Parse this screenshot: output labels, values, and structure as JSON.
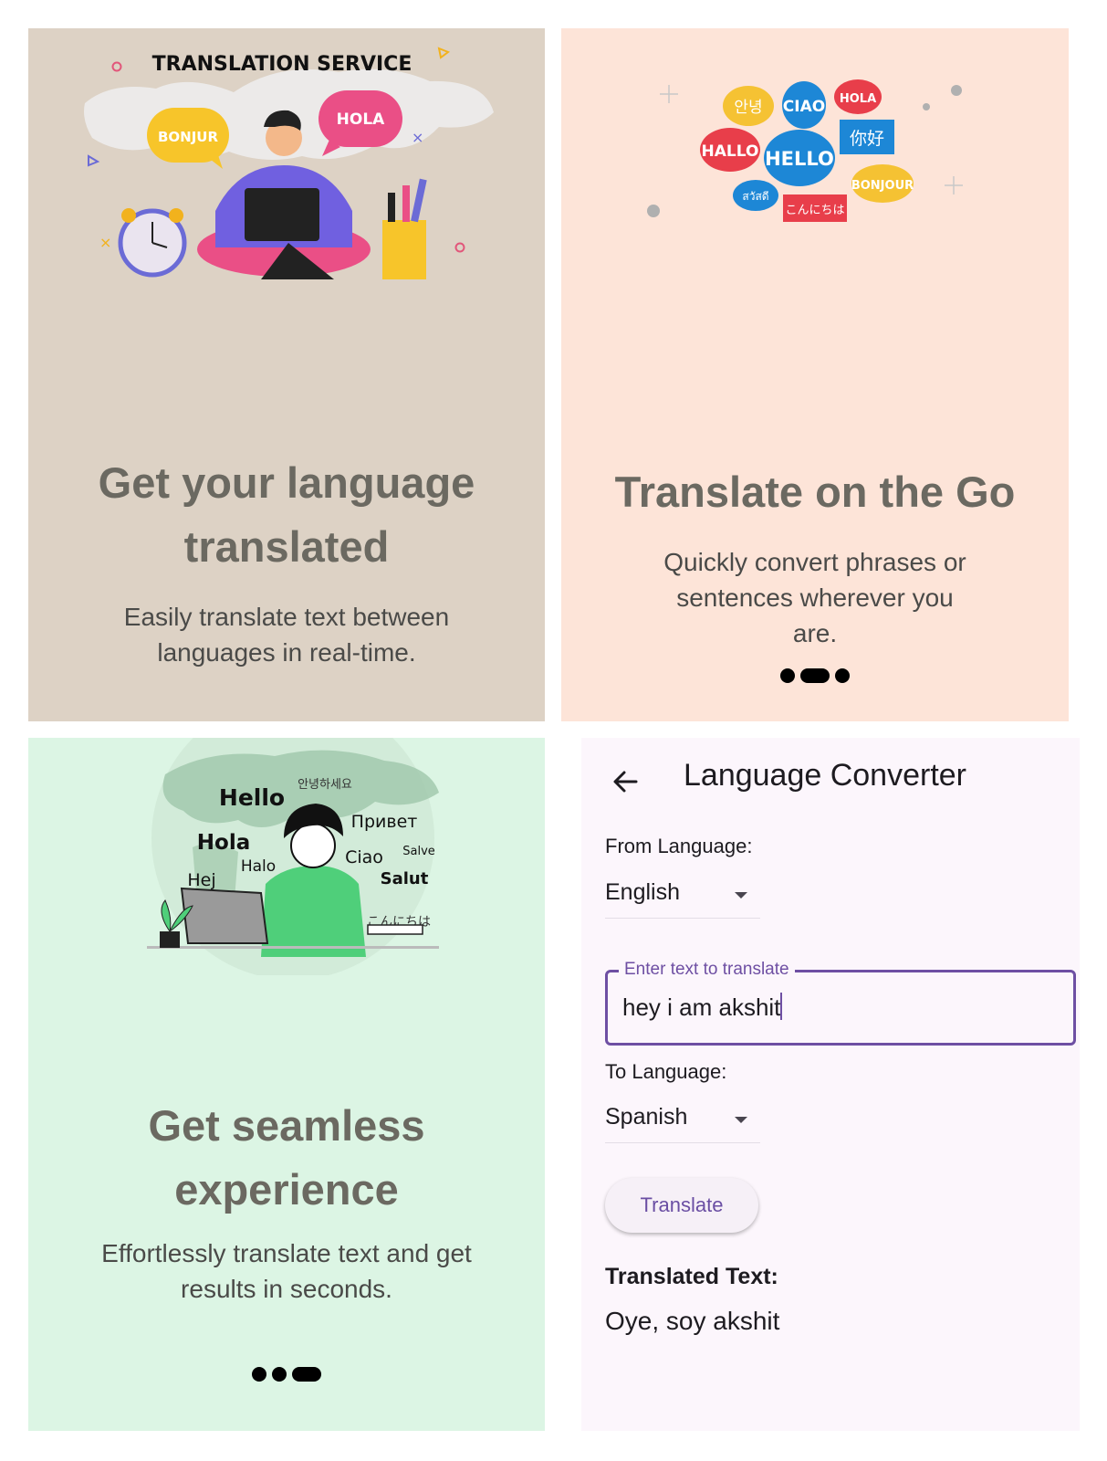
{
  "onboarding": [
    {
      "illustration": {
        "banner": "TRANSLATION SERVICE",
        "bubbles": [
          "BONJUR",
          "HOLA"
        ]
      },
      "title": "Get your language translated",
      "subtitle": "Easily translate text between languages in real-time.",
      "colors": {
        "background": "#ddd2c5"
      }
    },
    {
      "illustration": {
        "bubbles": [
          "안녕",
          "CIAO",
          "HOLA",
          "HALLO",
          "HELLO",
          "你好",
          "สวัสดี",
          "BONJOUR",
          "こんにちは"
        ]
      },
      "title": "Translate on the Go",
      "subtitle": "Quickly convert phrases or sentences wherever you are.",
      "page_indicator": {
        "total": 3,
        "active": 2
      },
      "colors": {
        "background": "#fde4d8"
      }
    },
    {
      "illustration": {
        "words": [
          "Hello",
          "안녕하세요",
          "Привет",
          "Hola",
          "Ciao",
          "Salve",
          "Halo",
          "Hej",
          "Salut",
          "こんにちは"
        ]
      },
      "title": "Get seamless experience",
      "subtitle": "Effortlessly translate text and get results in seconds.",
      "page_indicator": {
        "total": 3,
        "active": 3
      },
      "colors": {
        "background": "#dcf5e4"
      }
    }
  ],
  "converter": {
    "app_bar": {
      "title": "Language Converter",
      "back_icon": "arrow-left-icon"
    },
    "from_label": "From Language:",
    "from_value": "English",
    "input_label": "Enter text to translate",
    "input_value": "hey i am akshit",
    "to_label": "To Language:",
    "to_value": "Spanish",
    "translate_button": "Translate",
    "result_label": "Translated Text:",
    "result_value": "Oye, soy akshit",
    "colors": {
      "background": "#fcf6fc",
      "accent": "#6e4fa3"
    }
  }
}
